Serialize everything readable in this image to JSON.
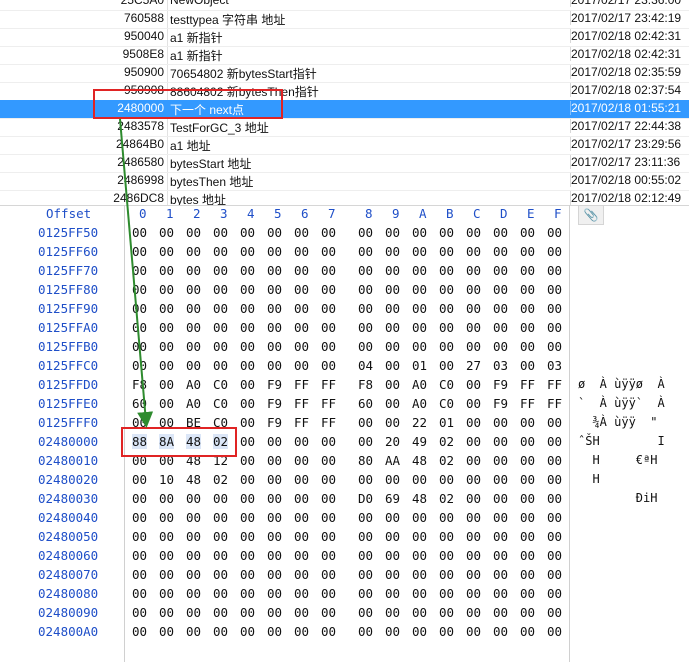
{
  "list": {
    "rows": [
      {
        "addr": "25C5A0",
        "desc": "NewObject",
        "time": "2017/02/17  23:36:00",
        "selected": false
      },
      {
        "addr": "760588",
        "desc": "testtypea 字符串 地址",
        "time": "2017/02/17  23:42:19",
        "selected": false
      },
      {
        "addr": "950040",
        "desc": "a1 新指针",
        "time": "2017/02/18  02:42:31",
        "selected": false
      },
      {
        "addr": "9508E8",
        "desc": "a1 新指针",
        "time": "2017/02/18  02:42:31",
        "selected": false
      },
      {
        "addr": "950900",
        "desc": "70654802  新bytesStart指针",
        "time": "2017/02/18  02:35:59",
        "selected": false
      },
      {
        "addr": "950908",
        "desc": "88604802 新bytesThen指针",
        "time": "2017/02/18  02:37:54",
        "selected": false
      },
      {
        "addr": "2480000",
        "desc": "下一个 next点",
        "time": "2017/02/18  01:55:21",
        "selected": true
      },
      {
        "addr": "2483578",
        "desc": "TestForGC_3 地址",
        "time": "2017/02/17  22:44:38",
        "selected": false
      },
      {
        "addr": "24864B0",
        "desc": "a1 地址",
        "time": "2017/02/17  23:29:56",
        "selected": false
      },
      {
        "addr": "2486580",
        "desc": "bytesStart 地址",
        "time": "2017/02/17  23:11:36",
        "selected": false
      },
      {
        "addr": "2486998",
        "desc": "bytesThen 地址",
        "time": "2017/02/18  00:55:02",
        "selected": false
      },
      {
        "addr": "2486DC8",
        "desc": "bytes 地址",
        "time": "2017/02/18  02:12:49",
        "selected": false
      }
    ]
  },
  "hex": {
    "offset_label": "Offset",
    "columns": [
      "0",
      "1",
      "2",
      "3",
      "4",
      "5",
      "6",
      "7",
      "8",
      "9",
      "A",
      "B",
      "C",
      "D",
      "E",
      "F"
    ],
    "clip_icon": "paperclip-icon",
    "rows": [
      {
        "offset": "0125FF50",
        "bytes": [
          "00",
          "00",
          "00",
          "00",
          "00",
          "00",
          "00",
          "00",
          "00",
          "00",
          "00",
          "00",
          "00",
          "00",
          "00",
          "00"
        ],
        "ascii": ""
      },
      {
        "offset": "0125FF60",
        "bytes": [
          "00",
          "00",
          "00",
          "00",
          "00",
          "00",
          "00",
          "00",
          "00",
          "00",
          "00",
          "00",
          "00",
          "00",
          "00",
          "00"
        ],
        "ascii": ""
      },
      {
        "offset": "0125FF70",
        "bytes": [
          "00",
          "00",
          "00",
          "00",
          "00",
          "00",
          "00",
          "00",
          "00",
          "00",
          "00",
          "00",
          "00",
          "00",
          "00",
          "00"
        ],
        "ascii": ""
      },
      {
        "offset": "0125FF80",
        "bytes": [
          "00",
          "00",
          "00",
          "00",
          "00",
          "00",
          "00",
          "00",
          "00",
          "00",
          "00",
          "00",
          "00",
          "00",
          "00",
          "00"
        ],
        "ascii": ""
      },
      {
        "offset": "0125FF90",
        "bytes": [
          "00",
          "00",
          "00",
          "00",
          "00",
          "00",
          "00",
          "00",
          "00",
          "00",
          "00",
          "00",
          "00",
          "00",
          "00",
          "00"
        ],
        "ascii": ""
      },
      {
        "offset": "0125FFA0",
        "bytes": [
          "00",
          "00",
          "00",
          "00",
          "00",
          "00",
          "00",
          "00",
          "00",
          "00",
          "00",
          "00",
          "00",
          "00",
          "00",
          "00"
        ],
        "ascii": ""
      },
      {
        "offset": "0125FFB0",
        "bytes": [
          "00",
          "00",
          "00",
          "00",
          "00",
          "00",
          "00",
          "00",
          "00",
          "00",
          "00",
          "00",
          "00",
          "00",
          "00",
          "00"
        ],
        "ascii": ""
      },
      {
        "offset": "0125FFC0",
        "bytes": [
          "00",
          "00",
          "00",
          "00",
          "00",
          "00",
          "00",
          "00",
          "04",
          "00",
          "01",
          "00",
          "27",
          "03",
          "00",
          "03"
        ],
        "ascii": ""
      },
      {
        "offset": "0125FFD0",
        "bytes": [
          "F8",
          "00",
          "A0",
          "C0",
          "00",
          "F9",
          "FF",
          "FF",
          "F8",
          "00",
          "A0",
          "C0",
          "00",
          "F9",
          "FF",
          "FF"
        ],
        "ascii": "ø  À ùÿÿø  À"
      },
      {
        "offset": "0125FFE0",
        "bytes": [
          "60",
          "00",
          "A0",
          "C0",
          "00",
          "F9",
          "FF",
          "FF",
          "60",
          "00",
          "A0",
          "C0",
          "00",
          "F9",
          "FF",
          "FF"
        ],
        "ascii": "`  À ùÿÿ`  À"
      },
      {
        "offset": "0125FFF0",
        "bytes": [
          "00",
          "00",
          "BE",
          "C0",
          "00",
          "F9",
          "FF",
          "FF",
          "00",
          "00",
          "22",
          "01",
          "00",
          "00",
          "00",
          "00"
        ],
        "ascii": "  ¾À ùÿÿ  \""
      },
      {
        "offset": "02480000",
        "bytes": [
          "88",
          "8A",
          "48",
          "02",
          "00",
          "00",
          "00",
          "00",
          "00",
          "20",
          "49",
          "02",
          "00",
          "00",
          "00",
          "00"
        ],
        "ascii": "ˆŠH        I"
      },
      {
        "offset": "02480010",
        "bytes": [
          "00",
          "00",
          "48",
          "12",
          "00",
          "00",
          "00",
          "00",
          "80",
          "AA",
          "48",
          "02",
          "00",
          "00",
          "00",
          "00"
        ],
        "ascii": "  H     €ªH"
      },
      {
        "offset": "02480020",
        "bytes": [
          "00",
          "10",
          "48",
          "02",
          "00",
          "00",
          "00",
          "00",
          "00",
          "00",
          "00",
          "00",
          "00",
          "00",
          "00",
          "00"
        ],
        "ascii": "  H"
      },
      {
        "offset": "02480030",
        "bytes": [
          "00",
          "00",
          "00",
          "00",
          "00",
          "00",
          "00",
          "00",
          "D0",
          "69",
          "48",
          "02",
          "00",
          "00",
          "00",
          "00"
        ],
        "ascii": "        ÐiH"
      },
      {
        "offset": "02480040",
        "bytes": [
          "00",
          "00",
          "00",
          "00",
          "00",
          "00",
          "00",
          "00",
          "00",
          "00",
          "00",
          "00",
          "00",
          "00",
          "00",
          "00"
        ],
        "ascii": ""
      },
      {
        "offset": "02480050",
        "bytes": [
          "00",
          "00",
          "00",
          "00",
          "00",
          "00",
          "00",
          "00",
          "00",
          "00",
          "00",
          "00",
          "00",
          "00",
          "00",
          "00"
        ],
        "ascii": ""
      },
      {
        "offset": "02480060",
        "bytes": [
          "00",
          "00",
          "00",
          "00",
          "00",
          "00",
          "00",
          "00",
          "00",
          "00",
          "00",
          "00",
          "00",
          "00",
          "00",
          "00"
        ],
        "ascii": ""
      },
      {
        "offset": "02480070",
        "bytes": [
          "00",
          "00",
          "00",
          "00",
          "00",
          "00",
          "00",
          "00",
          "00",
          "00",
          "00",
          "00",
          "00",
          "00",
          "00",
          "00"
        ],
        "ascii": ""
      },
      {
        "offset": "02480080",
        "bytes": [
          "00",
          "00",
          "00",
          "00",
          "00",
          "00",
          "00",
          "00",
          "00",
          "00",
          "00",
          "00",
          "00",
          "00",
          "00",
          "00"
        ],
        "ascii": ""
      },
      {
        "offset": "02480090",
        "bytes": [
          "00",
          "00",
          "00",
          "00",
          "00",
          "00",
          "00",
          "00",
          "00",
          "00",
          "00",
          "00",
          "00",
          "00",
          "00",
          "00"
        ],
        "ascii": ""
      },
      {
        "offset": "024800A0",
        "bytes": [
          "00",
          "00",
          "00",
          "00",
          "00",
          "00",
          "00",
          "00",
          "00",
          "00",
          "00",
          "00",
          "00",
          "00",
          "00",
          "00"
        ],
        "ascii": ""
      }
    ]
  },
  "annotation": {
    "box_color": "#e02424",
    "arrow_color": "#2e8b2e"
  }
}
